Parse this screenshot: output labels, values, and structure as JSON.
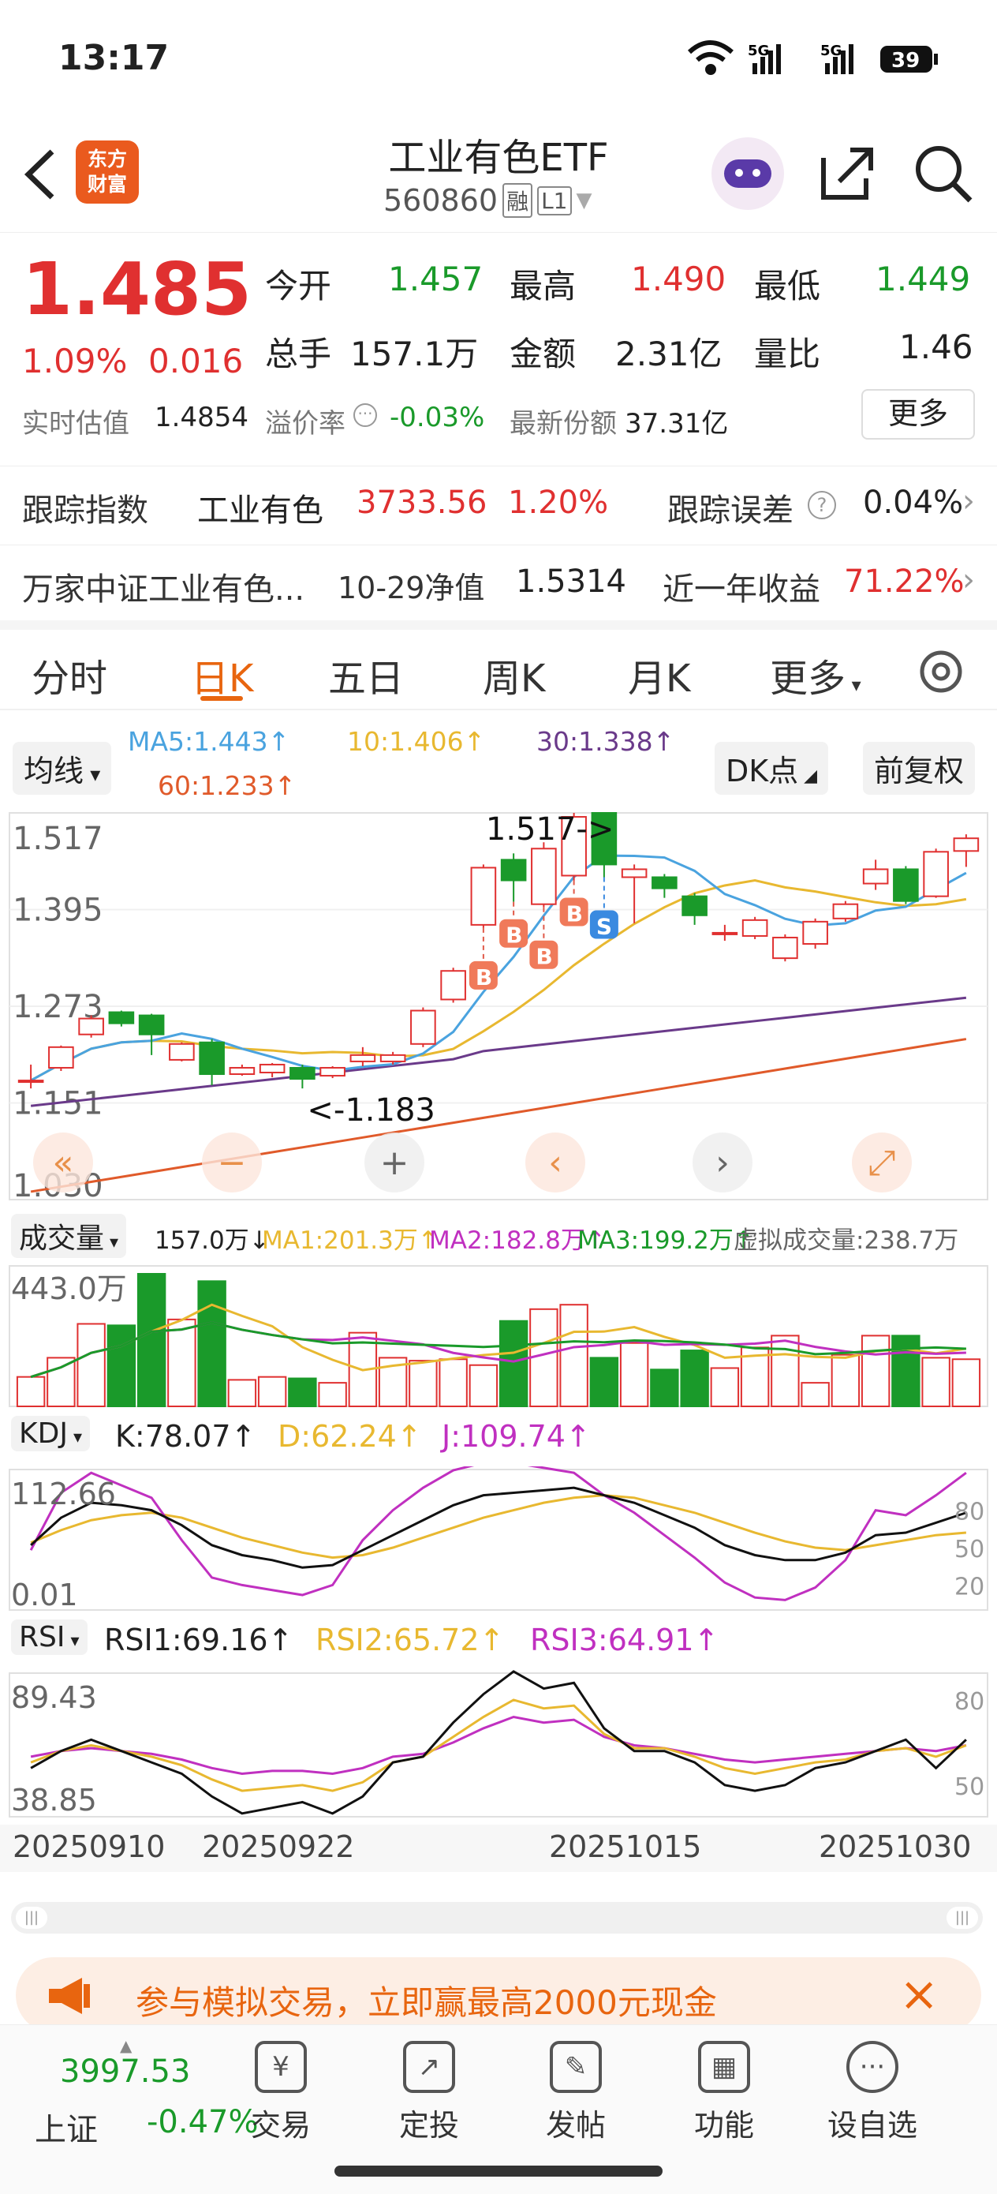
{
  "status": {
    "time": "13:17",
    "signal1": "5G",
    "signal2": "5G",
    "battery": "39"
  },
  "header": {
    "logo_line1": "东方",
    "logo_line2": "财富",
    "title": "工业有色ETF",
    "code": "560860",
    "tag1": "融",
    "tag2": "L1",
    "icons": [
      "back-icon",
      "share-icon",
      "search-icon",
      "robot-icon"
    ]
  },
  "quote": {
    "price": "1.485",
    "pct": "1.09%",
    "change": "0.016",
    "open_label": "今开",
    "open": "1.457",
    "high_label": "最高",
    "high": "1.490",
    "low_label": "最低",
    "low": "1.449",
    "vol_label": "总手",
    "vol": "157.1万",
    "amt_label": "金额",
    "amt": "2.31亿",
    "ratio_label": "量比",
    "ratio": "1.46",
    "iopv_label": "实时估值",
    "iopv": "1.4854",
    "premium_label": "溢价率",
    "premium": "-0.03%",
    "shares_label": "最新份额",
    "shares": "37.31亿",
    "more": "更多"
  },
  "track": {
    "label": "跟踪指数",
    "index": "工业有色",
    "value": "3733.56",
    "pct": "1.20%",
    "err_label": "跟踪误差",
    "err": "0.04%"
  },
  "fund": {
    "name": "万家中证工业有色...",
    "nav_label": "10-29净值",
    "nav": "1.5314",
    "ret_label": "近一年收益",
    "ret": "71.22%"
  },
  "tabs": [
    "分时",
    "日K",
    "五日",
    "周K",
    "月K",
    "更多"
  ],
  "active_tab": 1,
  "ma": {
    "btn": "均线",
    "ma5": "MA5:1.443↑",
    "ma10": "10:1.406↑",
    "ma30": "30:1.338↑",
    "ma60": "60:1.233↑",
    "dk": "DK点",
    "fq": "前复权"
  },
  "colors": {
    "up": "#e03030",
    "down": "#1a9a2a",
    "ma5": "#4aa3df",
    "ma10": "#e8b830",
    "ma30": "#6a3a8a",
    "ma60": "#e05a2a",
    "accent": "#e8650f"
  },
  "chart_data": {
    "type": "candlestick",
    "y_ticks": [
      "1.517",
      "1.395",
      "1.273",
      "1.151",
      "1.030"
    ],
    "ylim": [
      1.03,
      1.517
    ],
    "annotations": [
      "1.517->",
      "<-1.183"
    ],
    "signals": [
      "B",
      "B",
      "B",
      "B",
      "S"
    ],
    "candles": [
      {
        "o": 1.18,
        "c": 1.18,
        "h": 1.2,
        "l": 1.17
      },
      {
        "o": 1.196,
        "c": 1.222,
        "h": 1.224,
        "l": 1.192
      },
      {
        "o": 1.238,
        "c": 1.258,
        "h": 1.262,
        "l": 1.234
      },
      {
        "o": 1.266,
        "c": 1.252,
        "h": 1.268,
        "l": 1.248
      },
      {
        "o": 1.262,
        "c": 1.238,
        "h": 1.264,
        "l": 1.212
      },
      {
        "o": 1.206,
        "c": 1.226,
        "h": 1.228,
        "l": 1.204
      },
      {
        "o": 1.228,
        "c": 1.188,
        "h": 1.232,
        "l": 1.174
      },
      {
        "o": 1.188,
        "c": 1.196,
        "h": 1.2,
        "l": 1.186
      },
      {
        "o": 1.19,
        "c": 1.2,
        "h": 1.202,
        "l": 1.184
      },
      {
        "o": 1.196,
        "c": 1.182,
        "h": 1.2,
        "l": 1.17
      },
      {
        "o": 1.186,
        "c": 1.196,
        "h": 1.198,
        "l": 1.183
      },
      {
        "o": 1.204,
        "c": 1.212,
        "h": 1.222,
        "l": 1.198
      },
      {
        "o": 1.204,
        "c": 1.212,
        "h": 1.216,
        "l": 1.2
      },
      {
        "o": 1.226,
        "c": 1.268,
        "h": 1.272,
        "l": 1.222
      },
      {
        "o": 1.282,
        "c": 1.318,
        "h": 1.322,
        "l": 1.278
      },
      {
        "o": 1.376,
        "c": 1.448,
        "h": 1.452,
        "l": 1.372
      },
      {
        "o": 1.458,
        "c": 1.432,
        "h": 1.466,
        "l": 1.405
      },
      {
        "o": 1.402,
        "c": 1.472,
        "h": 1.48,
        "l": 1.398
      },
      {
        "o": 1.438,
        "c": 1.512,
        "h": 1.517,
        "l": 1.432
      },
      {
        "o": 1.517,
        "c": 1.452,
        "h": 1.517,
        "l": 1.436
      },
      {
        "o": 1.436,
        "c": 1.446,
        "h": 1.452,
        "l": 1.378
      },
      {
        "o": 1.436,
        "c": 1.422,
        "h": 1.44,
        "l": 1.41
      },
      {
        "o": 1.412,
        "c": 1.388,
        "h": 1.416,
        "l": 1.376
      },
      {
        "o": 1.366,
        "c": 1.366,
        "h": 1.376,
        "l": 1.356
      },
      {
        "o": 1.362,
        "c": 1.382,
        "h": 1.386,
        "l": 1.358
      },
      {
        "o": 1.334,
        "c": 1.36,
        "h": 1.364,
        "l": 1.33
      },
      {
        "o": 1.352,
        "c": 1.38,
        "h": 1.384,
        "l": 1.346
      },
      {
        "o": 1.384,
        "c": 1.402,
        "h": 1.406,
        "l": 1.38
      },
      {
        "o": 1.428,
        "c": 1.446,
        "h": 1.458,
        "l": 1.42
      },
      {
        "o": 1.446,
        "c": 1.406,
        "h": 1.45,
        "l": 1.402
      },
      {
        "o": 1.412,
        "c": 1.468,
        "h": 1.472,
        "l": 1.41
      },
      {
        "o": 1.469,
        "c": 1.485,
        "h": 1.49,
        "l": 1.449
      }
    ],
    "x_labels": [
      "20250910",
      "20250922",
      "20251015",
      "20251030"
    ]
  },
  "volume": {
    "btn": "成交量",
    "cur": "157.0万↓",
    "ma1": "MA1:201.3万↑",
    "ma2": "MA2:182.8万↑",
    "ma3": "MA3:199.2万↑",
    "virt": "虚拟成交量:238.7万",
    "ymax": "443.0万"
  },
  "kdj": {
    "btn": "KDJ",
    "k": "K:78.07↑",
    "d": "D:62.24↑",
    "j": "J:109.74↑",
    "ymax": "112.66",
    "ymin": "0.01",
    "lv80": "80",
    "lv50": "50",
    "lv20": "20"
  },
  "rsi": {
    "btn": "RSI",
    "r1": "RSI1:69.16↑",
    "r2": "RSI2:65.72↑",
    "r3": "RSI3:64.91↑",
    "ymax": "89.43",
    "ymin": "38.85",
    "lv80": "80",
    "lv50": "50"
  },
  "banner": {
    "text": "参与模拟交易，立即赢最高2000元现金"
  },
  "bottom": {
    "index_value": "3997.53",
    "index_name": "上证",
    "index_pct": "-0.47%",
    "nav": [
      "交易",
      "定投",
      "发帖",
      "功能",
      "设自选"
    ]
  }
}
